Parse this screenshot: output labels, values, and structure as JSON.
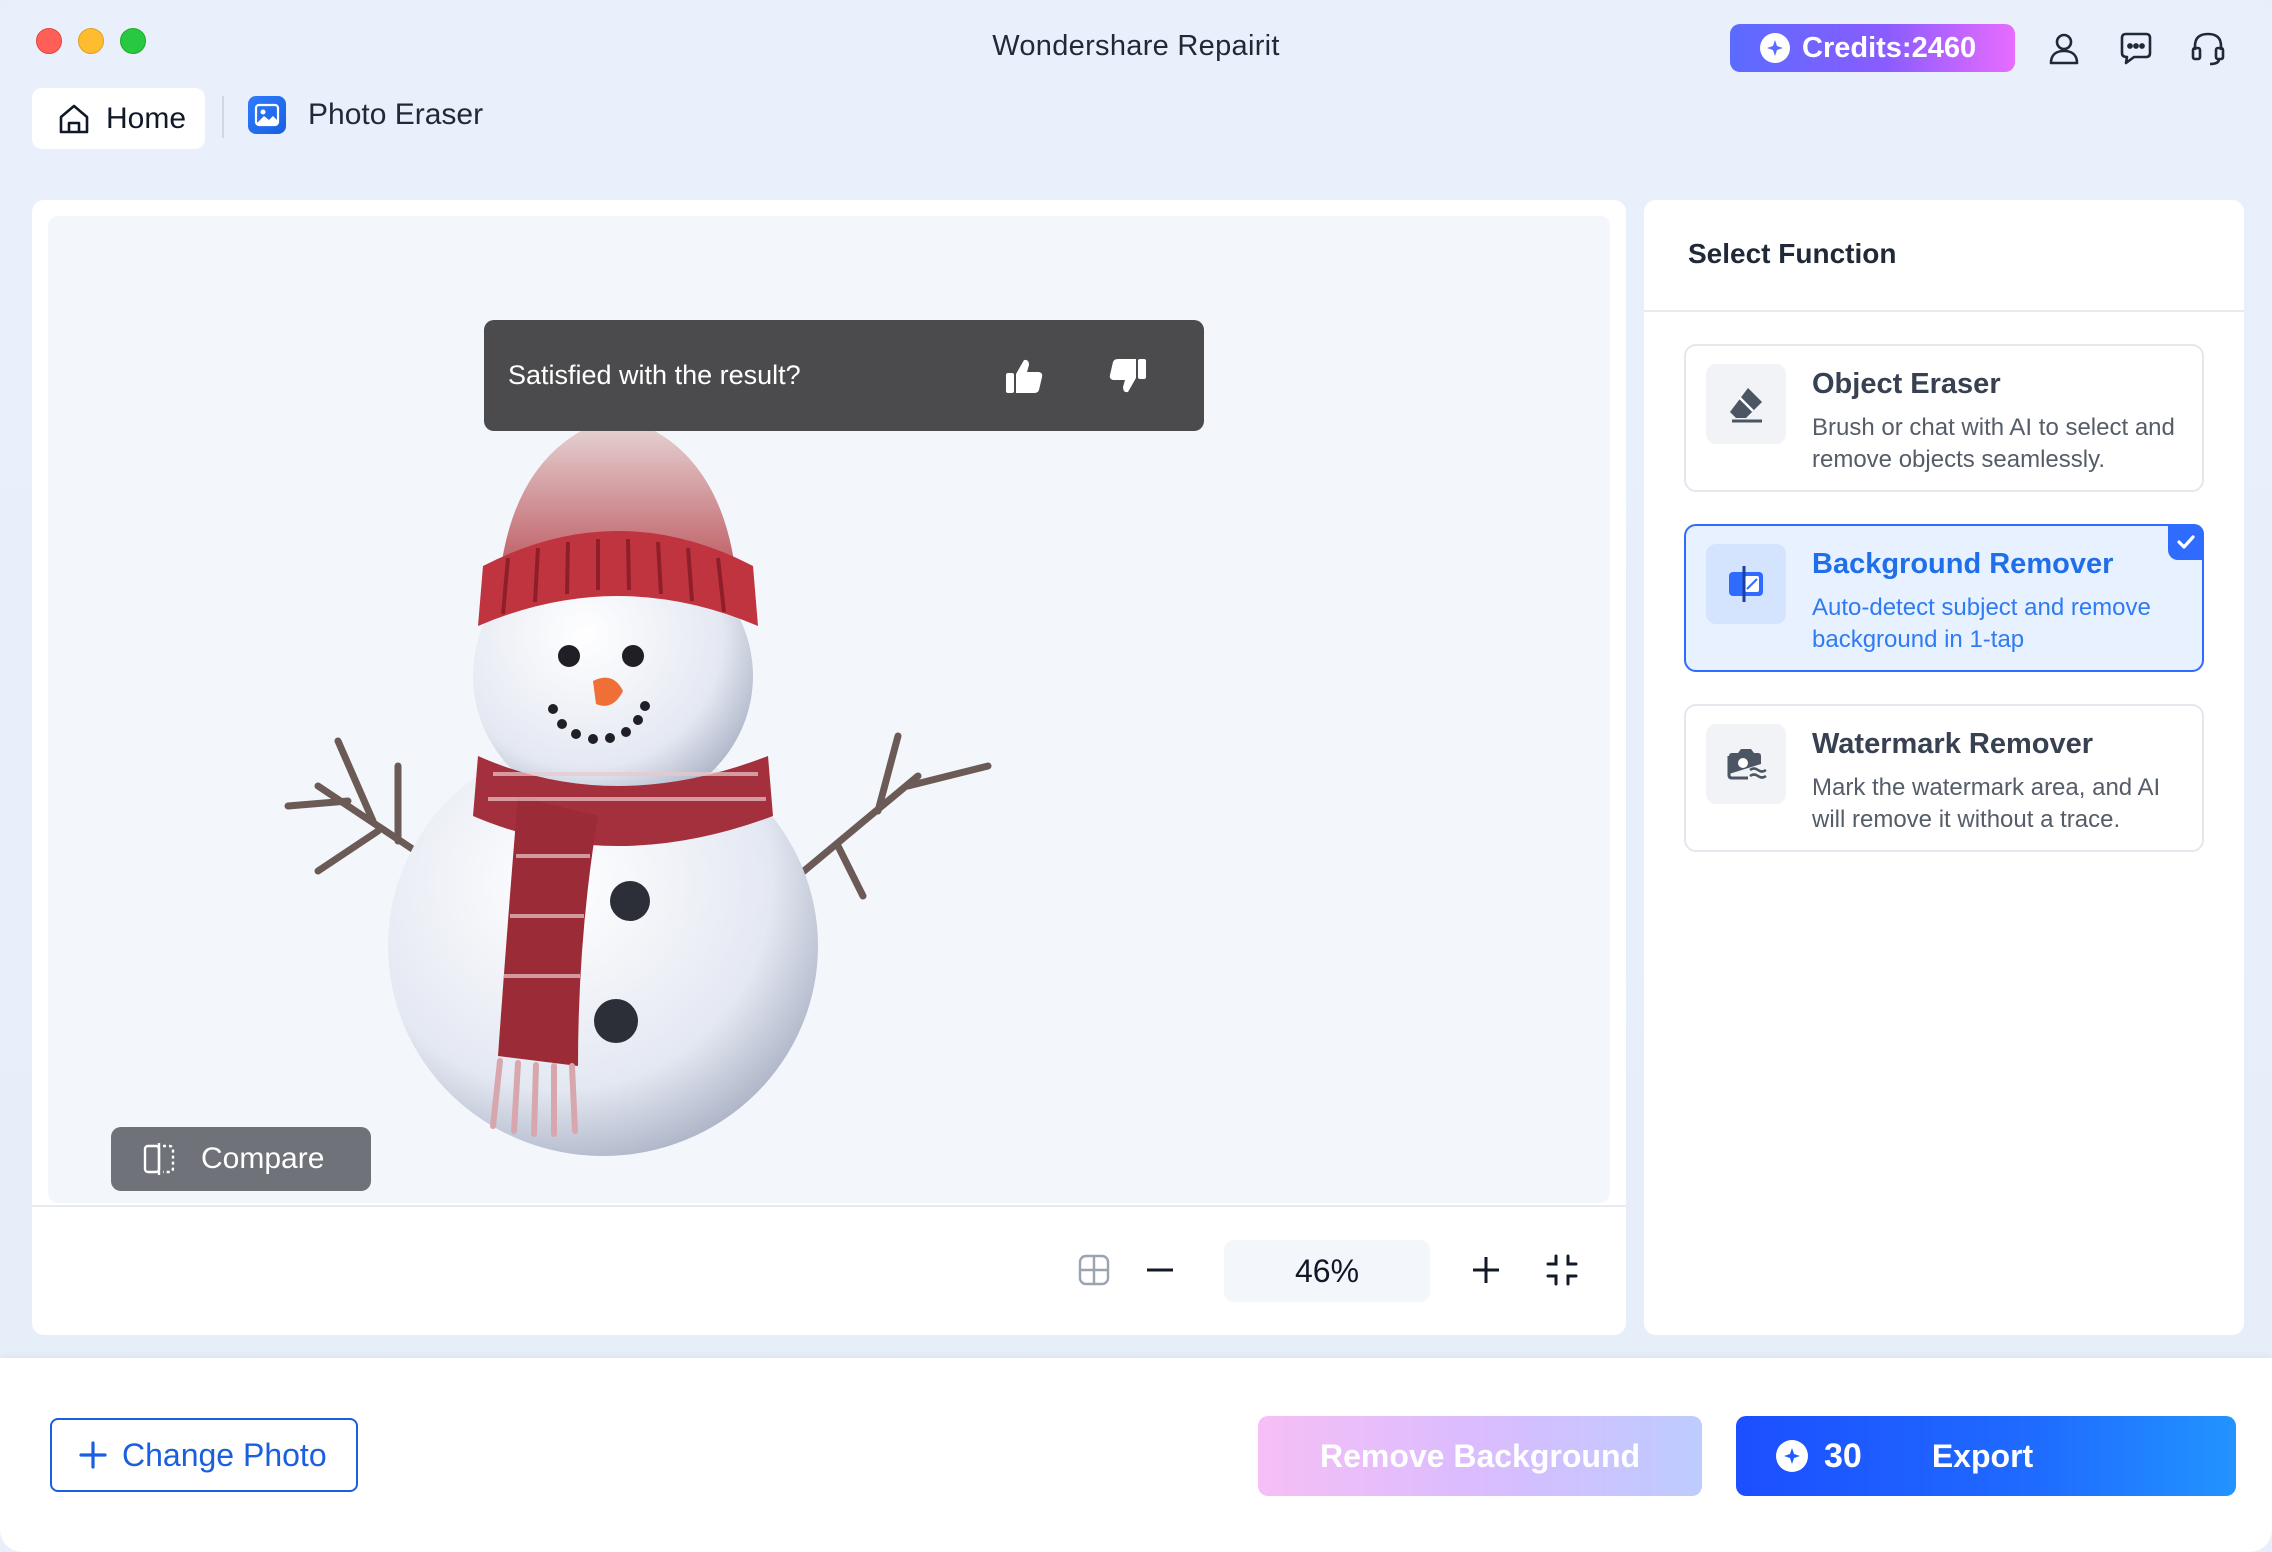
{
  "window": {
    "title": "Wondershare Repairit"
  },
  "header": {
    "credits_label": "Credits:2460",
    "icons": [
      "account-icon",
      "feedback-chat-icon",
      "support-headset-icon"
    ]
  },
  "nav": {
    "home_label": "Home",
    "breadcrumb_label": "Photo Eraser"
  },
  "canvas": {
    "feedback_prompt": "Satisfied with the result?",
    "compare_label": "Compare",
    "zoom_level": "46%"
  },
  "side_panel": {
    "title": "Select Function",
    "functions": [
      {
        "title": "Object Eraser",
        "description": "Brush or chat with AI to select and remove objects seamlessly.",
        "selected": false,
        "icon": "eraser-icon"
      },
      {
        "title": "Background Remover",
        "description": "Auto-detect subject and remove background in 1-tap",
        "selected": true,
        "icon": "background-remover-icon"
      },
      {
        "title": "Watermark Remover",
        "description": "Mark the watermark area, and AI will remove it without a trace.",
        "selected": false,
        "icon": "watermark-icon"
      }
    ]
  },
  "bottom": {
    "change_photo_label": "Change Photo",
    "remove_background_label": "Remove Background",
    "export_cost": "30",
    "export_label": "Export"
  },
  "colors": {
    "accent": "#1f6bff",
    "selected_card_bg": "#e8f1ff",
    "feedback_bg": "#4b4b4d"
  }
}
